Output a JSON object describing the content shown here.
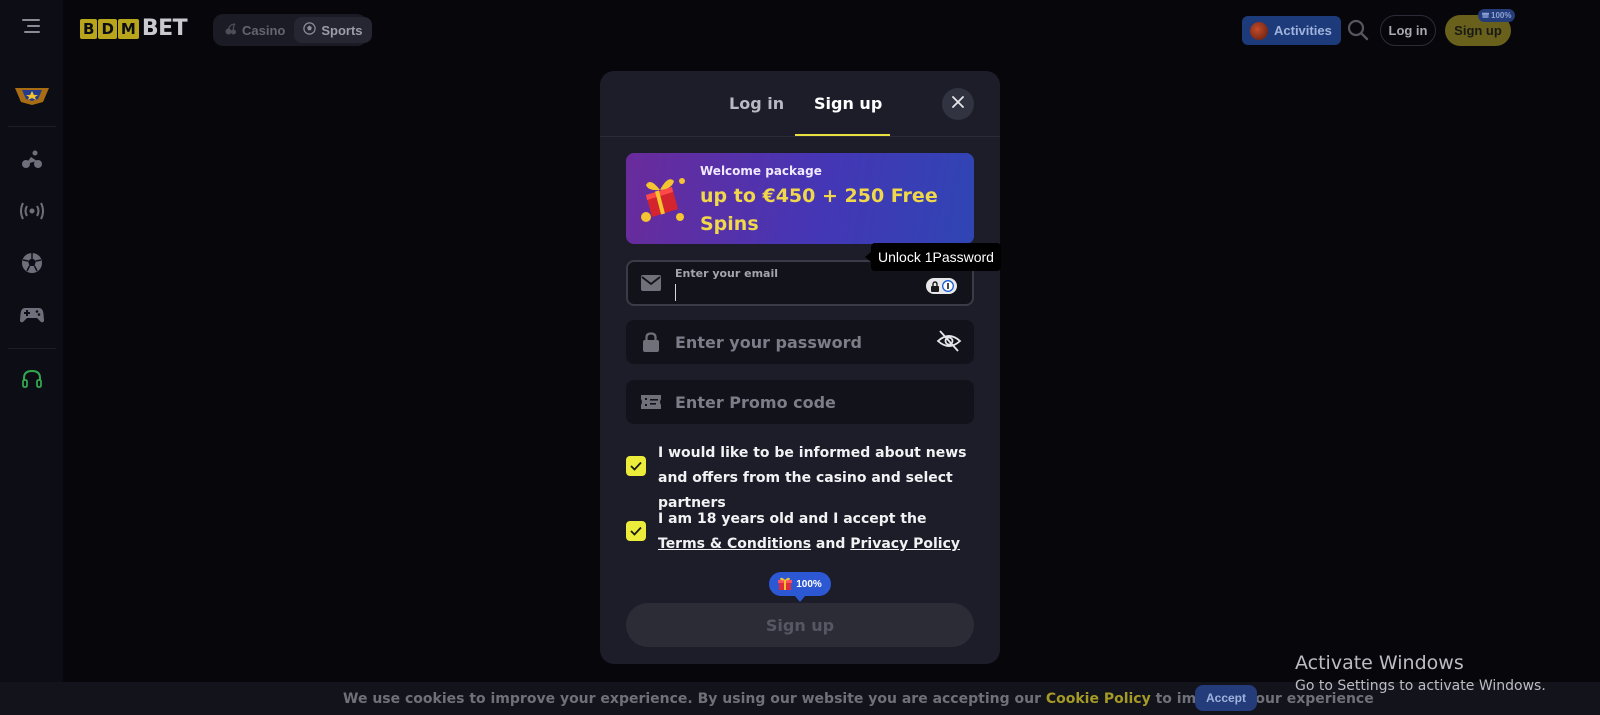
{
  "topbar": {
    "logo_box": [
      "B",
      "D",
      "M"
    ],
    "logo_text": "BET",
    "nav": [
      {
        "label": "Casino",
        "icon": "cherries-icon"
      },
      {
        "label": "Sports",
        "icon": "soccer-ball-icon"
      }
    ],
    "activities_label": "Activities",
    "login_label": "Log in",
    "signup_label": "Sign up",
    "signup_badge": "100%"
  },
  "sidebar": {
    "icons": [
      "menu-icon",
      "vip-badge-icon",
      "bicycle-icon",
      "live-broadcast-icon",
      "soccer-ball-icon",
      "gamepad-icon",
      "headset-icon"
    ]
  },
  "modal": {
    "tabs": [
      {
        "label": "Log in"
      },
      {
        "label": "Sign up"
      }
    ],
    "banner": {
      "package_label": "Welcome package",
      "offer": "up to €450 + 250 Free Spins"
    },
    "email": {
      "label": "Enter your email",
      "value": ""
    },
    "password": {
      "placeholder": "Enter your password"
    },
    "promo": {
      "placeholder": "Enter Promo code"
    },
    "consent_news": "I would like to be informed about news and offers from the casino and select partners",
    "consent_age": {
      "prefix": "I am 18 years old and I accept the ",
      "terms_link": "Terms & Conditions",
      "middle": " and ",
      "privacy_link": "Privacy Policy"
    },
    "bonus_badge": "100%",
    "submit_label": "Sign up"
  },
  "password_manager": {
    "tooltip": "Unlock 1Password"
  },
  "cookie_bar": {
    "text_before": "We use cookies to improve your experience. By using our website you are accepting our ",
    "policy_link": "Cookie Policy",
    "text_after": " to improve your experience",
    "accept_label": "Accept"
  },
  "watermark": {
    "title": "Activate Windows",
    "subtitle": "Go to Settings to activate Windows."
  },
  "colors": {
    "accent_yellow": "#ecec3a",
    "modal_bg": "#1c1d28",
    "page_bg": "#07070b",
    "banner_offer": "#f0d84a",
    "activities_bg": "#1d3a7a"
  }
}
